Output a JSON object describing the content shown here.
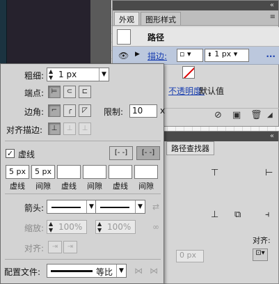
{
  "appearance_panel": {
    "tabs": [
      "外观",
      "图形样式"
    ],
    "path_label": "路径",
    "stroke_label": "描边:",
    "stroke_weight": "1 px",
    "more": "...",
    "opacity_label": "不透明度:",
    "opacity_value": "默认值"
  },
  "pathfinder_panel": {
    "tab": "路径查找器",
    "align_label": "对齐:",
    "ghost_value": "0 px"
  },
  "stroke_panel": {
    "weight_label": "粗细:",
    "weight_value": "1 px",
    "cap_label": "端点:",
    "corner_label": "边角:",
    "limit_label": "限制:",
    "limit_value": "10",
    "limit_unit": "x",
    "align_label": "对齐描边:",
    "dashed_label": "虚线",
    "dashed_checked": true,
    "dash_values": [
      "5 px",
      "5 px",
      "",
      "",
      "",
      ""
    ],
    "dash_captions": [
      "虚线",
      "间隙",
      "虚线",
      "间隙",
      "虚线",
      "间隙"
    ],
    "arrow_label": "箭头:",
    "scale_label": "缩放:",
    "scale_start": "100%",
    "scale_end": "100%",
    "arrow_align_label": "对齐:",
    "profile_label": "配置文件:",
    "profile_value": "等比"
  },
  "icons": [
    "eye-icon",
    "menu-icon",
    "delete-icon",
    "new-item-icon",
    "clear-icon",
    "link-icon",
    "swap-icon",
    "flip-icon"
  ]
}
